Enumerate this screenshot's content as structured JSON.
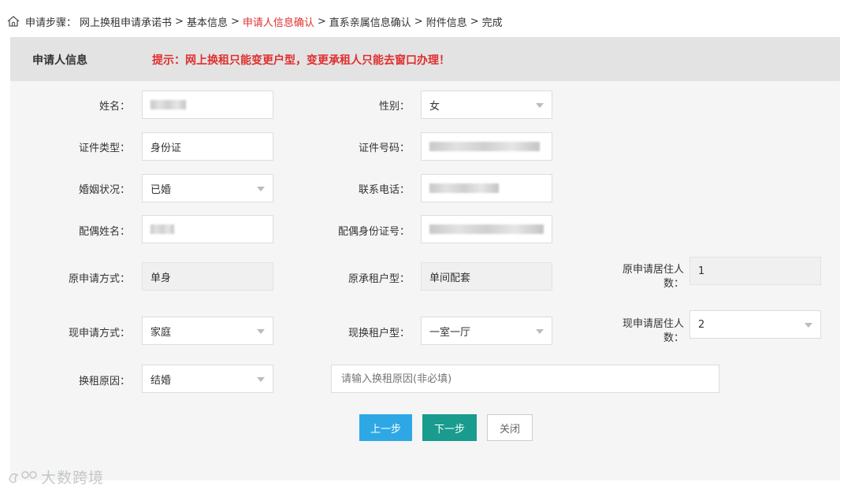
{
  "breadcrumb": {
    "prefix": "申请步骤：",
    "steps": [
      "网上换租申请承诺书",
      "基本信息",
      "申请人信息确认",
      "直系亲属信息确认",
      "附件信息",
      "完成"
    ],
    "separator": ">"
  },
  "section": {
    "title": "申请人信息",
    "tip": "提示：网上换租只能变更户型，变更承租人只能去窗口办理！"
  },
  "form": {
    "name_label": "姓名：",
    "gender_label": "性别：",
    "gender_value": "女",
    "id_type_label": "证件类型：",
    "id_type_value": "身份证",
    "id_number_label": "证件号码：",
    "marital_label": "婚姻状况：",
    "marital_value": "已婚",
    "phone_label": "联系电话：",
    "spouse_name_label": "配偶姓名：",
    "spouse_id_label": "配偶身份证号：",
    "orig_apply_label": "原申请方式：",
    "orig_apply_value": "单身",
    "orig_type_label": "原承租户型：",
    "orig_type_value": "单间配套",
    "orig_count_label_1": "原申请居住人",
    "orig_count_label_2": "数：",
    "orig_count_value": "1",
    "cur_apply_label": "现申请方式：",
    "cur_apply_value": "家庭",
    "cur_type_label": "现换租户型：",
    "cur_type_value": "一室一厅",
    "cur_count_label_1": "现申请居住人",
    "cur_count_label_2": "数：",
    "cur_count_value": "2",
    "reason_label": "换租原因：",
    "reason_value": "结婚",
    "reason_placeholder": "请输入换租原因(非必填)"
  },
  "buttons": {
    "prev": "上一步",
    "next": "下一步",
    "close": "关闭"
  },
  "watermark": "大数跨境"
}
